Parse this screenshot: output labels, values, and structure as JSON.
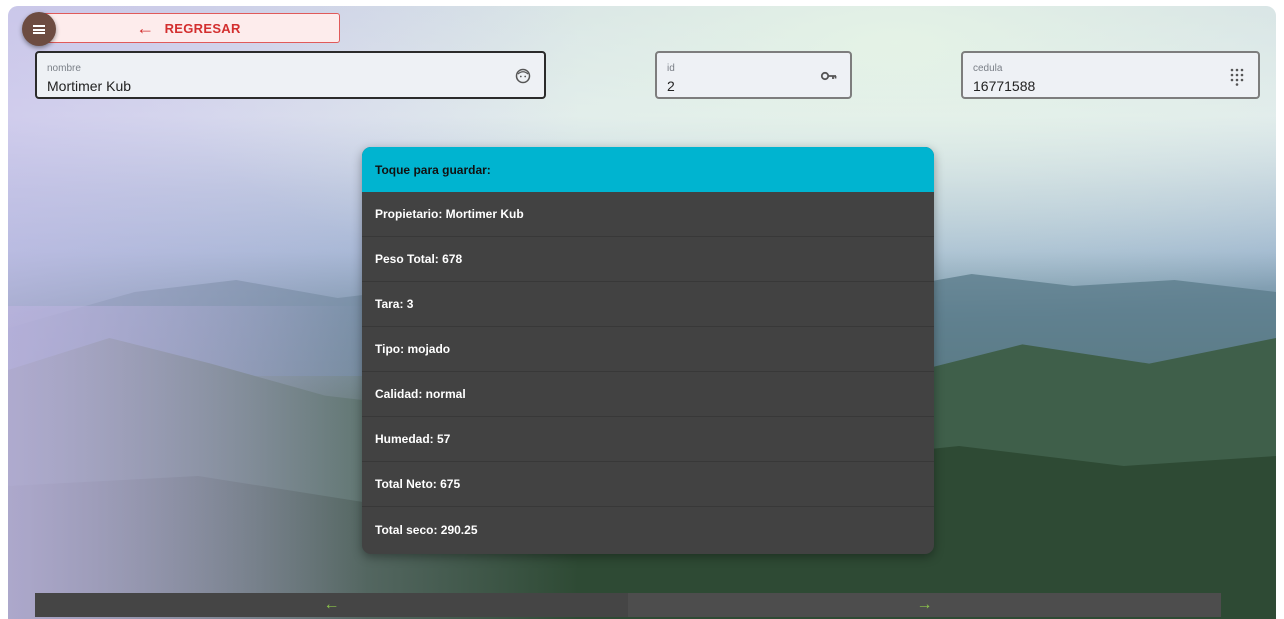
{
  "header": {
    "back_label": "REGRESAR",
    "back_icon": "arrow-left-icon",
    "menu_icon": "menu-icon"
  },
  "fields": {
    "nombre": {
      "label": "nombre",
      "value": "Mortimer Kub",
      "icon": "face-icon"
    },
    "id": {
      "label": "id",
      "value": "2",
      "icon": "key-icon"
    },
    "cedula": {
      "label": "cedula",
      "value": "16771588",
      "icon": "dialpad-icon"
    }
  },
  "card": {
    "header": "Toque para guardar:",
    "rows": [
      "Propietario: Mortimer Kub",
      "Peso Total: 678",
      "Tara: 3",
      "Tipo: mojado",
      "Calidad: normal",
      "Humedad: 57",
      "Total Neto: 675",
      "Total seco: 290.25"
    ]
  },
  "bottom_nav": {
    "prev_icon": "arrow-left-icon",
    "next_icon": "arrow-right-icon",
    "prev_glyph": "←",
    "next_glyph": "→"
  },
  "colors": {
    "accent": "#00b4d0",
    "danger": "#d32f2f",
    "nav_arrow": "#8bc34a",
    "card_bg": "#424242",
    "fab": "#6d4c41"
  }
}
